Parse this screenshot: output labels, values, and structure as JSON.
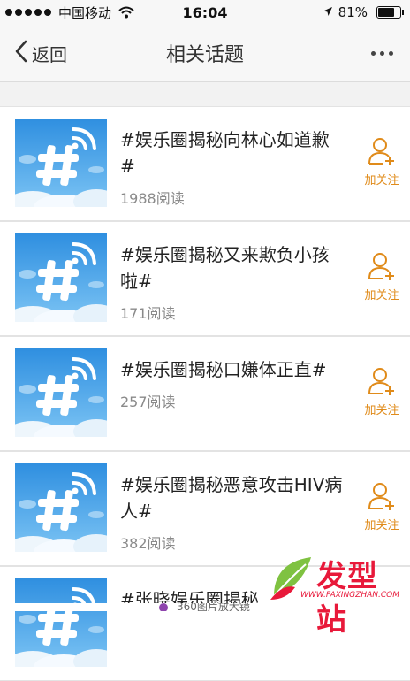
{
  "status": {
    "carrier": "中国移动",
    "time": "16:04",
    "battery": "81%",
    "battery_level": 0.81
  },
  "nav": {
    "back_label": "返回",
    "title": "相关话题"
  },
  "topics": [
    {
      "title": "#娱乐圈揭秘向林心如道歉#",
      "reads": "1988阅读",
      "follow_label": "加关注"
    },
    {
      "title": "#娱乐圈揭秘又来欺负小孩啦#",
      "reads": "171阅读",
      "follow_label": "加关注"
    },
    {
      "title": "#娱乐圈揭秘口嫌体正直#",
      "reads": "257阅读",
      "follow_label": "加关注"
    },
    {
      "title": "#娱乐圈揭秘恶意攻击HIV病人#",
      "reads": "382阅读",
      "follow_label": "加关注"
    },
    {
      "title": "#张晓娱乐圈揭秘",
      "reads": "",
      "follow_label": ""
    }
  ],
  "bottom": {
    "text": "360图片放大镜"
  },
  "watermark": {
    "text": "发型站",
    "url": "WWW.FAXINGZHAN.COM"
  },
  "colors": {
    "accent": "#e08b1a",
    "watermark": "#e8193a",
    "thumb_sky": "#3a9be3"
  }
}
